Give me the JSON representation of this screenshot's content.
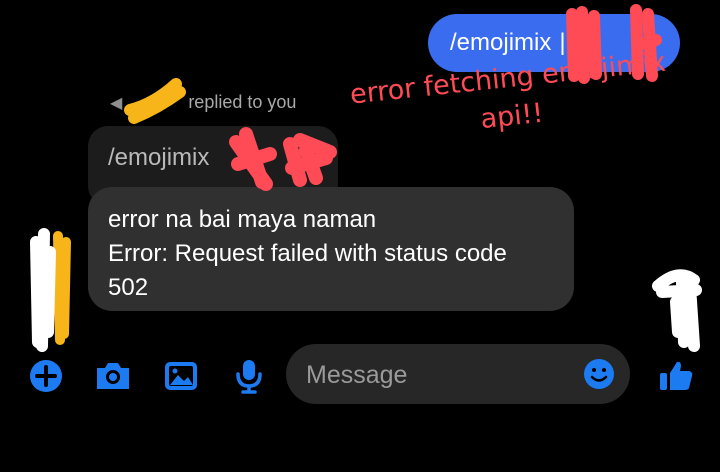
{
  "conversation": {
    "outgoing_message": "/emojimix",
    "outgoing_separator": "|",
    "reply_header_suffix": "replied to you",
    "quoted_message": "/emojimix",
    "reply_lines": [
      "error na bai maya naman",
      "Error: Request failed with status code",
      "502"
    ]
  },
  "annotation": {
    "line1": "error fetching emojimix",
    "line2": "api!!"
  },
  "composer": {
    "placeholder": "Message"
  },
  "icons": {
    "add": "plus-circle-icon",
    "camera": "camera-icon",
    "gallery": "image-icon",
    "mic": "microphone-icon",
    "emoji": "smiley-icon",
    "like": "thumbs-up-icon",
    "reply": "reply-arrow-icon"
  },
  "colors": {
    "background": "#000000",
    "accent": "#3a6cf0",
    "icon_blue": "#1d7bf2",
    "bubble_incoming": "#303030",
    "annotation_red": "#ff4b56"
  }
}
